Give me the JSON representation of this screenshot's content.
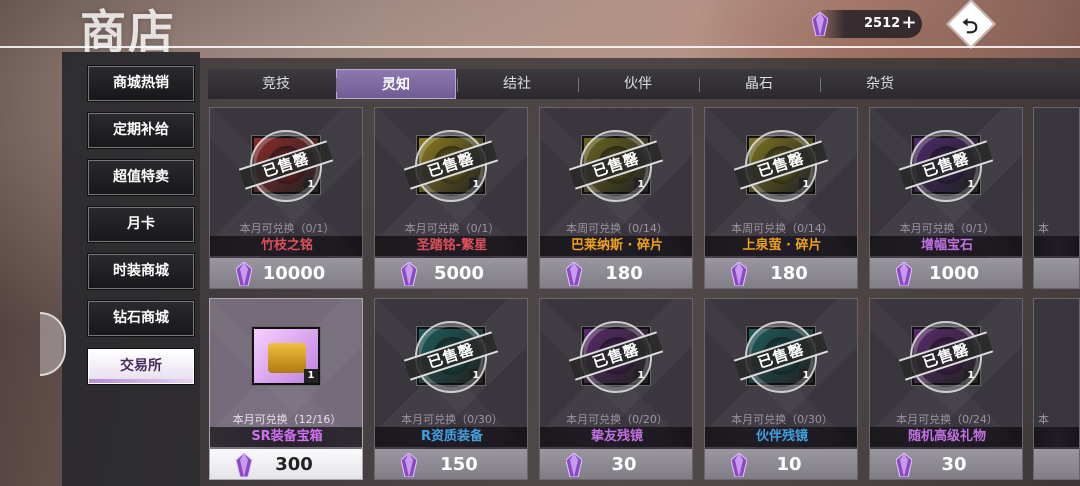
{
  "header": {
    "title": "商店",
    "currency_value": "2512"
  },
  "sidebar": {
    "items": [
      {
        "label": "商城热销"
      },
      {
        "label": "定期补给"
      },
      {
        "label": "超值特卖"
      },
      {
        "label": "月卡"
      },
      {
        "label": "时装商城"
      },
      {
        "label": "钻石商城"
      },
      {
        "label": "交易所"
      }
    ],
    "active_index": 6
  },
  "tabs": [
    {
      "label": "竞技"
    },
    {
      "label": "灵知"
    },
    {
      "label": "结社"
    },
    {
      "label": "伙伴"
    },
    {
      "label": "晶石"
    },
    {
      "label": "杂货"
    }
  ],
  "active_tab": "灵知",
  "sold_stamp_text": "已售罄",
  "items": [
    {
      "name": "竹枝之铭",
      "limit": "本月可兑换（0/1）",
      "price": "10000",
      "count": "1",
      "sold_out": true,
      "name_color": "#e0505a",
      "icon_color": "#8a2a2a"
    },
    {
      "name": "圣踏铭-繁星",
      "limit": "本月可兑换（0/1）",
      "price": "5000",
      "count": "1",
      "sold_out": true,
      "name_color": "#e0505a",
      "icon_color": "#8a7a20"
    },
    {
      "name": "巴莱纳斯 · 碎片",
      "limit": "本周可兑换（0/14）",
      "price": "180",
      "count": "1",
      "sold_out": true,
      "name_color": "#f0a020",
      "icon_color": "#6a6420"
    },
    {
      "name": "上泉萤 · 碎片",
      "limit": "本周可兑换（0/14）",
      "price": "180",
      "count": "1",
      "sold_out": true,
      "name_color": "#f0a020",
      "icon_color": "#7a7020"
    },
    {
      "name": "增幅宝石",
      "limit": "本月可兑换（0/1）",
      "price": "1000",
      "count": "1",
      "sold_out": true,
      "name_color": "#c070e0",
      "icon_color": "#4a2a6a"
    },
    {
      "name": "SR装备宝箱",
      "limit": "本月可兑换（12/16）",
      "price": "300",
      "count": "1",
      "sold_out": false,
      "name_color": "#d070f0",
      "icon_color": "#e0b030"
    },
    {
      "name": "R资质装备",
      "limit": "本月可兑换（0/30）",
      "price": "150",
      "count": "1",
      "sold_out": true,
      "name_color": "#40a0e0",
      "icon_color": "#1e5a5a"
    },
    {
      "name": "挚友残镜",
      "limit": "本月可兑换（0/20）",
      "price": "30",
      "count": "1",
      "sold_out": true,
      "name_color": "#c070e0",
      "icon_color": "#5a2a6a"
    },
    {
      "name": "伙伴残镜",
      "limit": "本月可兑换（0/30）",
      "price": "10",
      "count": "1",
      "sold_out": true,
      "name_color": "#40a0e0",
      "icon_color": "#1e5a5a"
    },
    {
      "name": "随机高级礼物",
      "limit": "本月可兑换（0/24）",
      "price": "30",
      "count": "1",
      "sold_out": true,
      "name_color": "#c070e0",
      "icon_color": "#5a2a6a"
    }
  ],
  "partial_column": {
    "limit_top": "本",
    "limit_bottom": "本"
  },
  "colors": {
    "accent": "#7a66a0",
    "gem": "#9a5ad0"
  }
}
